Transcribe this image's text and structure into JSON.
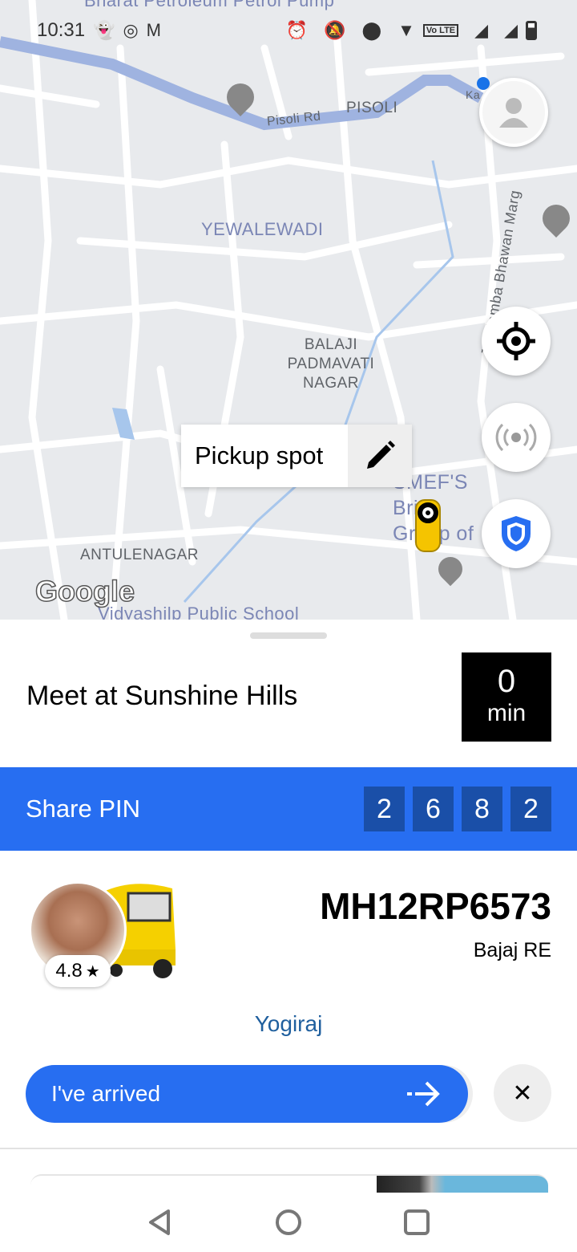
{
  "status_bar": {
    "time": "10:31",
    "notification_icons": [
      "snapchat-icon",
      "instagram-icon",
      "signal-app-icon",
      "gmail-icon"
    ],
    "system_icons": [
      "alarm-icon",
      "bell-off-icon",
      "location-icon",
      "wifi-icon",
      "volte-icon",
      "signal-icon",
      "signal-icon",
      "battery-icon"
    ],
    "volte": "Vo LTE"
  },
  "map": {
    "labels": [
      "Bharat Petroleum Petrol Pump",
      "Pisoli Rd",
      "PISOLI",
      "YEWALEWADI",
      "Jagdamba Bhawan Marg",
      "BALAJI PADMAVATI NAGAR",
      "SMEF'S Brick Group of Institutes",
      "ANTULENAGAR",
      "Vidyashilp Public School",
      "Ka"
    ],
    "pickup_label": "Pickup spot",
    "google_logo": "Google",
    "route_color": "#9fb3e0",
    "buttons": [
      "profile",
      "recenter",
      "safety-toolkit",
      "shield"
    ]
  },
  "trip": {
    "meet_text": "Meet at Sunshine Hills",
    "eta_value": "0",
    "eta_unit": "min"
  },
  "pin": {
    "label": "Share PIN",
    "digits": [
      "2",
      "6",
      "8",
      "2"
    ]
  },
  "driver": {
    "rating": "4.8",
    "star": "★",
    "plate": "MH12RP6573",
    "vehicle": "Bajaj RE",
    "name": "Yogiraj"
  },
  "actions": {
    "arrived_label": "I've arrived",
    "arrow": "⇢",
    "close": "✕"
  },
  "colors": {
    "accent": "#276ef1",
    "pin_digit_bg": "#1a4fa8",
    "eta_bg": "#000000"
  }
}
